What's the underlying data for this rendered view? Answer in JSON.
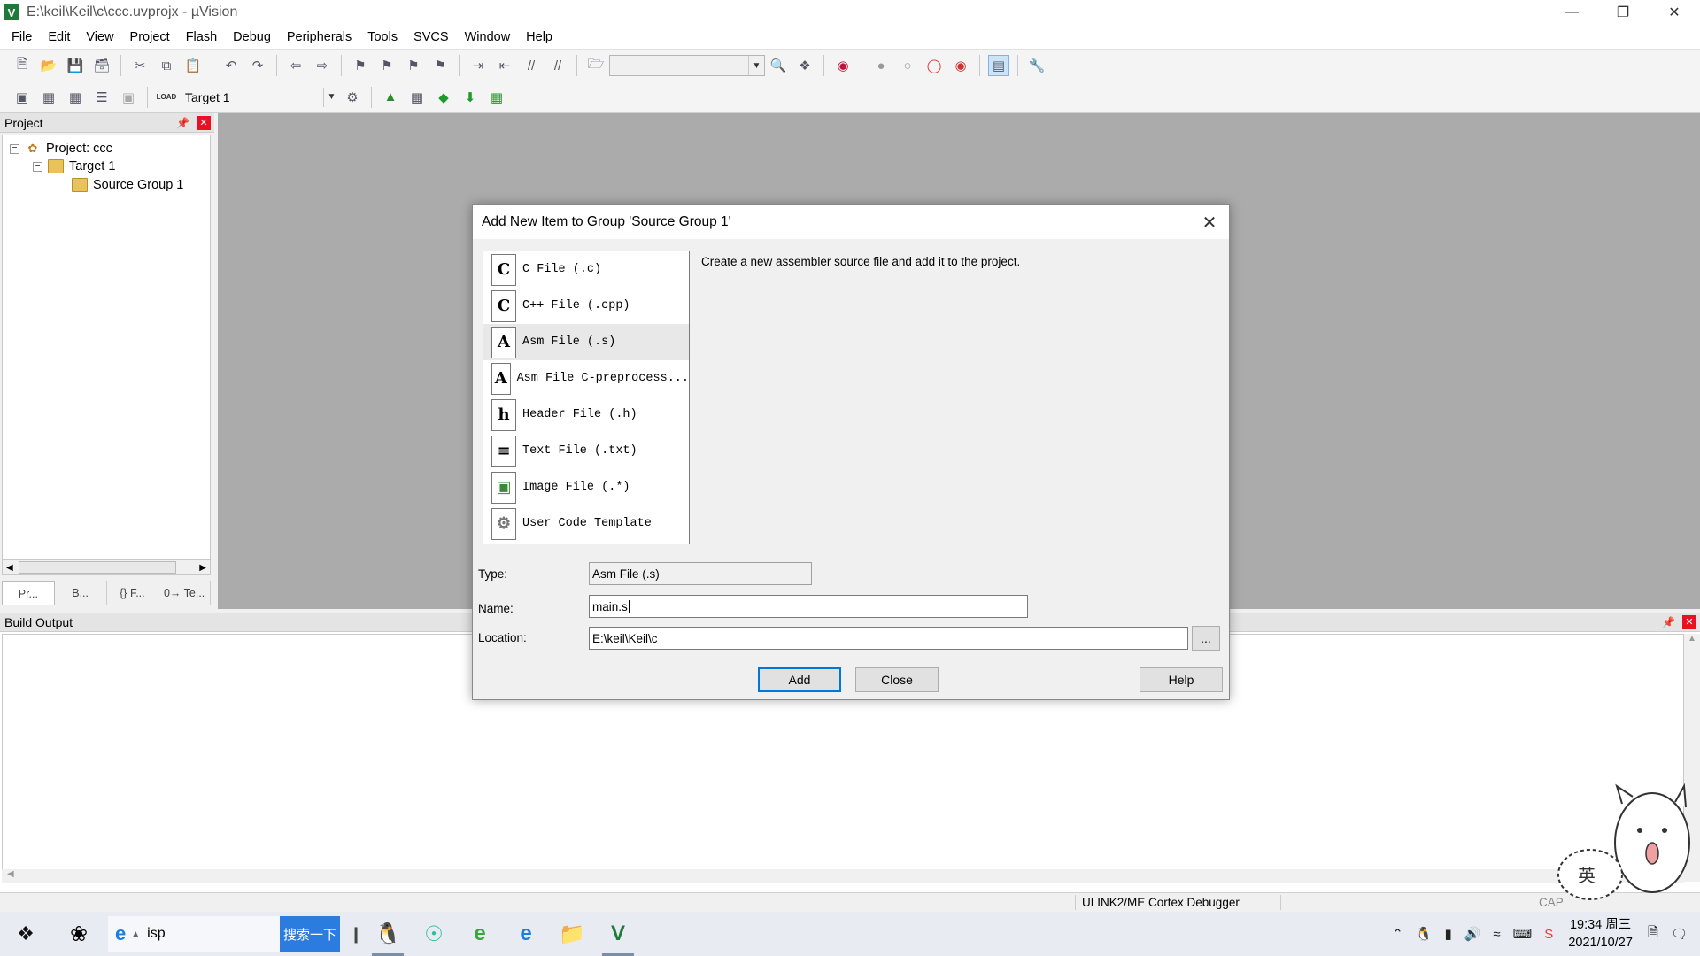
{
  "window": {
    "title": "E:\\keil\\Keil\\c\\ccc.uvprojx - µVision",
    "icon": "V"
  },
  "menu": [
    "File",
    "Edit",
    "View",
    "Project",
    "Flash",
    "Debug",
    "Peripherals",
    "Tools",
    "SVCS",
    "Window",
    "Help"
  ],
  "toolbar2": {
    "load_label": "LOAD",
    "target": "Target 1"
  },
  "project_panel": {
    "title": "Project",
    "root": "Project: ccc",
    "target": "Target 1",
    "group": "Source Group 1",
    "tabs": [
      "Pr...",
      "B...",
      "{} F...",
      "0→ Te..."
    ]
  },
  "build_output": {
    "title": "Build Output"
  },
  "status": {
    "debugger": "ULINK2/ME Cortex Debugger",
    "cap": "CAP"
  },
  "dialog": {
    "title": "Add New Item to Group 'Source Group 1'",
    "description": "Create a new assembler source file and add it to the project.",
    "items": [
      {
        "icon": "C",
        "label": "C File (.c)"
      },
      {
        "icon": "C",
        "label": "C++ File (.cpp)"
      },
      {
        "icon": "A",
        "label": "Asm File (.s)"
      },
      {
        "icon": "A",
        "label": "Asm File C-preprocess..."
      },
      {
        "icon": "h",
        "label": "Header File (.h)"
      },
      {
        "icon": "≡",
        "label": "Text File (.txt)"
      },
      {
        "icon": "▣",
        "label": "Image File (.*)"
      },
      {
        "icon": "⚙",
        "label": "User Code Template"
      }
    ],
    "type_label": "Type:",
    "type_value": "Asm File (.s)",
    "name_label": "Name:",
    "name_value": "main.s",
    "location_label": "Location:",
    "location_value": "E:\\keil\\Keil\\c",
    "browse_label": "...",
    "add_label": "Add",
    "close_label": "Close",
    "help_label": "Help"
  },
  "taskbar": {
    "search_text": "isp",
    "search_button": "搜索一下",
    "time": "19:34 周三",
    "date": "2021/10/27",
    "ime": "英"
  }
}
